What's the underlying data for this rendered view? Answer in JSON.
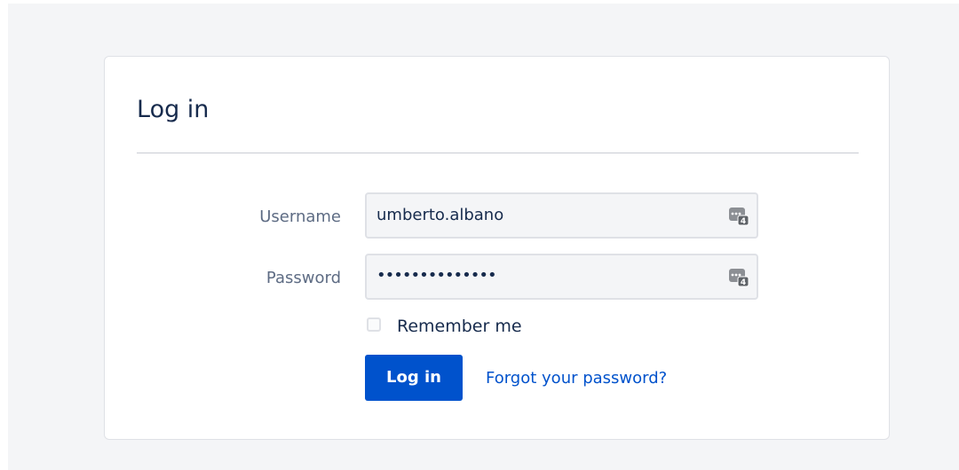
{
  "login": {
    "title": "Log in",
    "username_label": "Username",
    "username_value": "umberto.albano",
    "password_label": "Password",
    "password_value": "••••••••••••••",
    "remember_label": "Remember me",
    "remember_checked": false,
    "login_button": "Log in",
    "forgot_link": "Forgot your password?",
    "field_icon": "password-manager-icon"
  },
  "colors": {
    "primary": "#0052cc",
    "text": "#172b4d",
    "label": "#5e6c84",
    "background": "#f4f5f7",
    "border": "#dfe1e6"
  }
}
